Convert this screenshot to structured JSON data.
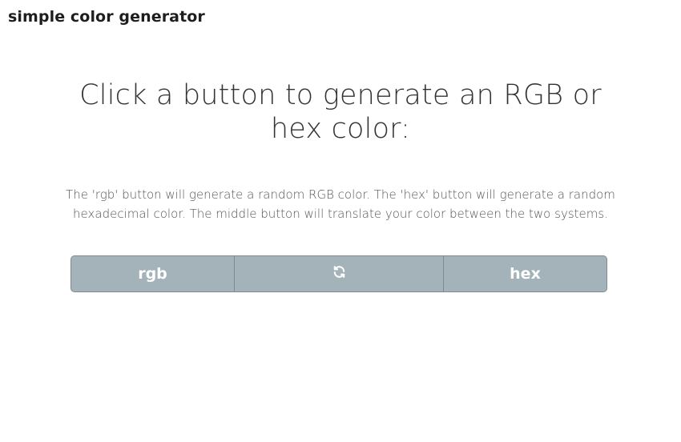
{
  "header": {
    "brand": "simple color generator"
  },
  "main": {
    "headline": "Click a button to generate an RGB or hex color:",
    "description": "The 'rgb' button will generate a random RGB color. The 'hex' button will generate a random hexadecimal color. The middle button will translate your color between the two systems."
  },
  "buttons": {
    "rgb_label": "rgb",
    "swap_icon": "refresh-icon",
    "hex_label": "hex"
  },
  "colors": {
    "button_bg": "#a3b3b9",
    "button_border": "#7f8b90",
    "button_text": "#ffffff"
  }
}
